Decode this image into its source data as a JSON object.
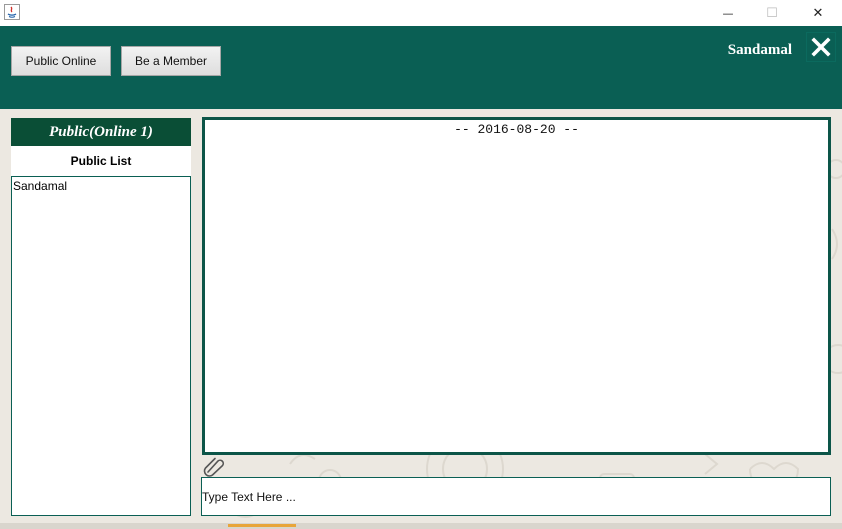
{
  "window": {
    "minimize_glyph": "—",
    "maximize_glyph": "☐",
    "close_glyph": "✕"
  },
  "header": {
    "public_online_label": "Public Online",
    "be_member_label": "Be a Member",
    "username": "Sandamal",
    "close_icon": "close-x-icon"
  },
  "left_panel": {
    "title": "Public(Online 1)",
    "subtitle": "Public List",
    "users": [
      "Sandamal"
    ]
  },
  "chat": {
    "date_line": "-- 2016-08-20 --",
    "attach_icon": "paperclip-icon"
  },
  "input": {
    "placeholder": "Type Text Here ..."
  },
  "colors": {
    "header_bg": "#0a5f54",
    "panel_title_bg": "#0a4e36",
    "content_bg": "#ece8e1",
    "accent": "#e8a53a"
  }
}
